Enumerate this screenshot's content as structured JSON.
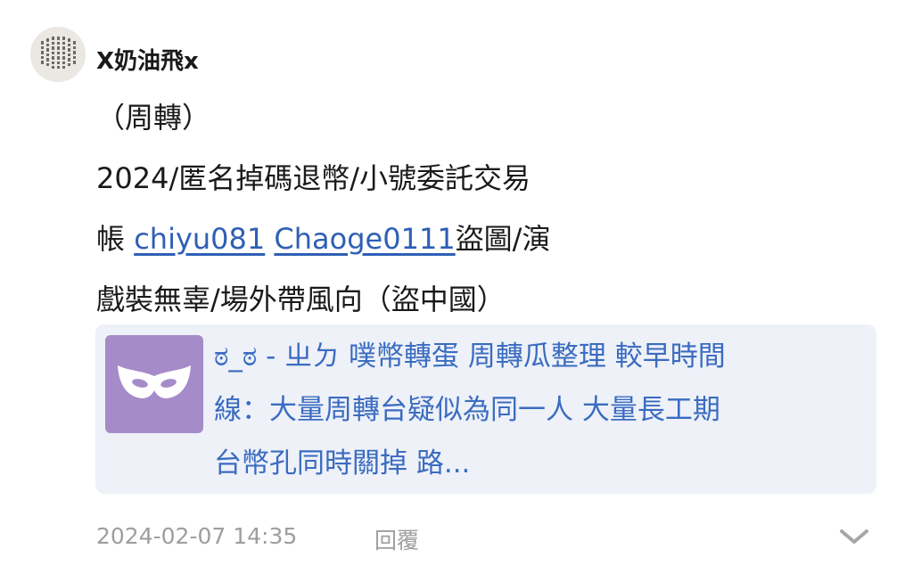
{
  "post": {
    "username": "X奶油飛x",
    "body_lines": [
      "（周轉）",
      "2024/匿名掉碼退幣/小號委託交易",
      {
        "prefix": "帳 ",
        "mention1": "chiyu081",
        "between": " ",
        "mention2": "Chaoge0111",
        "suffix": "盜圖/演"
      },
      "戲裝無辜/場外帶風向（盜中國）"
    ],
    "link_card": {
      "text_lines": [
        "ಠ_ಠ - ㄓㄉ 噗幣轉蛋 周轉瓜整理 較早時間",
        "線：大量周轉台疑似為同一人 大量長工期",
        "台幣孔同時關掉 路..."
      ],
      "thumb_color": "#a68bc9",
      "thumb_icon": "mask-icon"
    },
    "timestamp": "2024-02-07 14:35",
    "reply_label": "回覆",
    "expand_icon": "chevron-down-icon"
  },
  "colors": {
    "mention": "#2f5fb5",
    "card_text": "#3a6cc0",
    "card_bg": "#eef1f8",
    "meta": "#9e9e9e"
  }
}
